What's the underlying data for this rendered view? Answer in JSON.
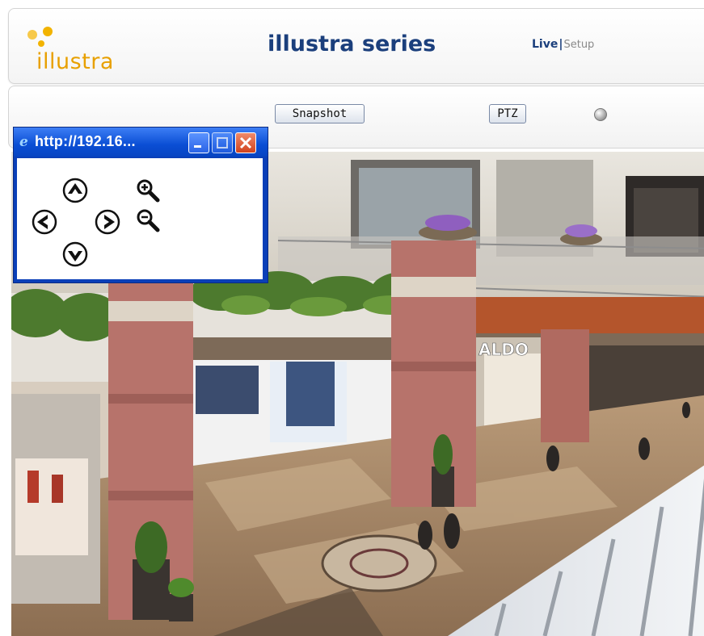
{
  "header": {
    "logo_text": "illustra",
    "title": "illustra series",
    "nav": {
      "live": "Live",
      "separator": "|",
      "setup": "Setup"
    }
  },
  "toolbar": {
    "snapshot_label": "Snapshot",
    "ptz_label": "PTZ",
    "status_indicator_icon": "status-dot-icon"
  },
  "ptz_window": {
    "title": "http://192.16...",
    "controls": [
      "pan-up-icon",
      "pan-left-icon",
      "pan-right-icon",
      "pan-down-icon",
      "zoom-in-icon",
      "zoom-out-icon"
    ]
  },
  "video": {
    "storefront_sign": "ALDO"
  },
  "colors": {
    "brand_navy": "#1b3f7c",
    "logo_orange": "#e8a000",
    "window_blue": "#0a4ed4",
    "close_red": "#d1421d"
  }
}
